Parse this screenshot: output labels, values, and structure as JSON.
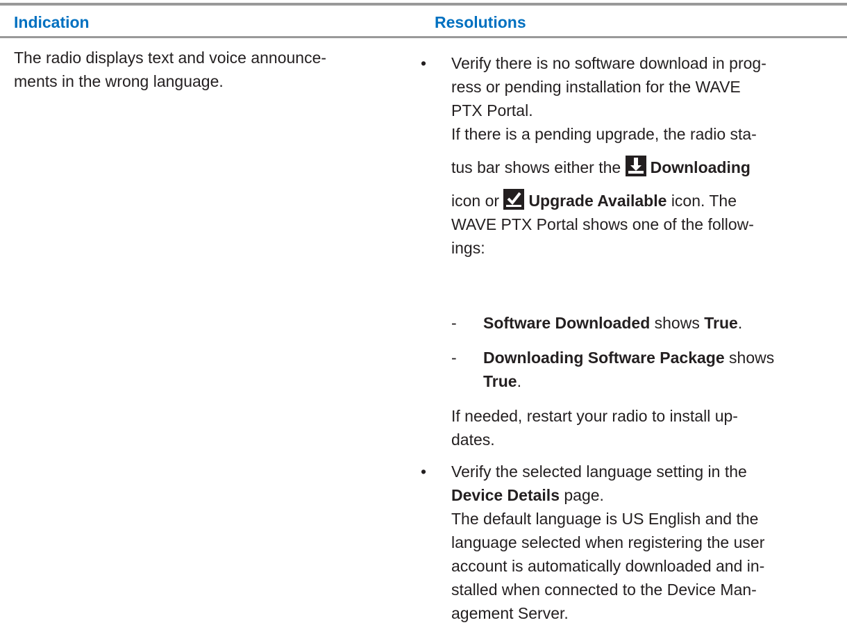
{
  "header": {
    "indication": "Indication",
    "resolutions": "Resolutions"
  },
  "indication_text": "The radio displays text and voice announce-ments in the wrong language.",
  "indication_lines": [
    "The radio displays text and voice announce-",
    "ments in the wrong language."
  ],
  "bullets": [
    "•",
    "•"
  ],
  "dashes": [
    "-",
    "-"
  ],
  "res1": {
    "lines": [
      "Verify there is no software download in prog-",
      "ress or pending installation for the WAVE",
      "PTX Portal."
    ],
    "sub_lines": [
      "If there is a pending upgrade, the radio sta-"
    ],
    "status_prefix": "tus bar shows either the",
    "downloading_label": "Downloading",
    "icon_or_prefix": "icon or",
    "upgrade_label": "Upgrade Available",
    "icon_suffix": "icon. The",
    "portal_lines": [
      "WAVE PTX Portal shows one of the follow-",
      "ings:"
    ],
    "item1_bold": "Software Downloaded",
    "item1_mid": "shows",
    "item1_value": "True",
    "item2_bold": "Downloading Software Package",
    "item2_mid": "shows",
    "item2_value": "True",
    "restart_lines": [
      "If needed, restart your radio to install up-",
      "dates."
    ]
  },
  "res2": {
    "line1": "Verify the selected language setting in the",
    "bold": "Device Details",
    "line2_suffix": "page.",
    "body_lines": [
      "The default language is US English and the",
      "language selected when registering the user",
      "account is automatically downloaded and in-",
      "stalled when connected to the Device Man-",
      "agement Server."
    ]
  },
  "punct": "."
}
